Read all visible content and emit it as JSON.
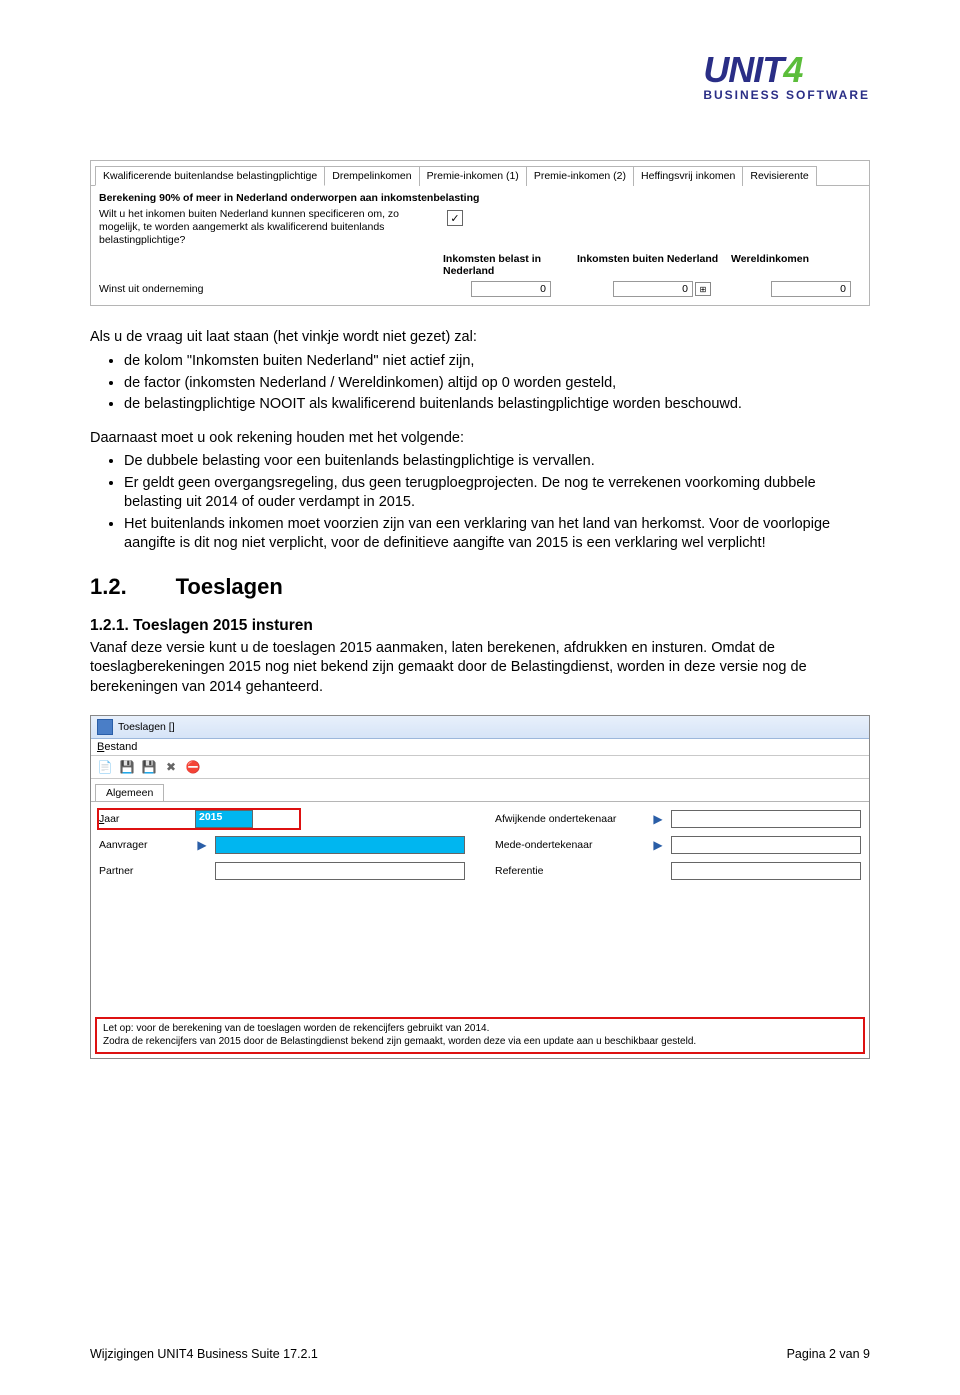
{
  "logo": {
    "main_a": "UNIT",
    "main_b": "4",
    "sub": "BUSINESS SOFTWARE"
  },
  "win1": {
    "tabs": [
      "Kwalificerende buitenlandse belastingplichtige",
      "Drempelinkomen",
      "Premie-inkomen (1)",
      "Premie-inkomen (2)",
      "Heffingsvrij inkomen",
      "Revisierente"
    ],
    "section_title": "Berekening 90% of meer in Nederland onderworpen aan inkomstenbelasting",
    "question": "Wilt u het inkomen buiten Nederland kunnen specificeren om, zo mogelijk, te worden aangemerkt als kwalificerend buitenlands belastingplichtige?",
    "checked": "✓",
    "col1": "Inkomsten belast in Nederland",
    "col2": "Inkomsten buiten Nederland",
    "col3": "Wereldinkomen",
    "row_label": "Winst uit onderneming",
    "v1": "0",
    "v2": "0",
    "v3": "0"
  },
  "body": {
    "intro": "Als u de vraag uit laat staan (het vinkje wordt niet gezet) zal:",
    "b1": "de kolom \"Inkomsten buiten Nederland\" niet actief zijn,",
    "b2": "de factor (inkomsten Nederland / Wereldinkomen) altijd op 0 worden gesteld,",
    "b3": "de belastingplichtige NOOIT als kwalificerend buitenlands belastingplichtige worden beschouwd.",
    "p2": "Daarnaast moet u ook rekening houden met het volgende:",
    "c1": "De dubbele belasting voor een buitenlands belastingplichtige is vervallen.",
    "c2": "Er geldt geen overgangsregeling, dus geen terugploegprojecten. De nog te verrekenen voorkoming dubbele belasting uit 2014 of ouder verdampt in 2015.",
    "c3": "Het buitenlands inkomen moet voorzien zijn van een verklaring van het land van herkomst. Voor de voorlopige aangifte is dit nog niet verplicht, voor de definitieve aangifte van 2015 is een verklaring wel verplicht!",
    "h2_num": "1.2.",
    "h2_title": "Toeslagen",
    "h3": "1.2.1.        Toeslagen 2015 insturen",
    "p3": "Vanaf deze versie kunt u de toeslagen 2015 aanmaken, laten berekenen, afdrukken en insturen. Omdat de toeslagberekeningen 2015 nog niet bekend zijn gemaakt door de Belastingdienst, worden in deze versie nog de berekeningen van 2014 gehanteerd."
  },
  "win2": {
    "title": "Toeslagen []",
    "menu_bestand": "Bestand",
    "tab": "Algemeen",
    "labels": {
      "jaar": "Jaar",
      "aanvrager": "Aanvrager",
      "partner": "Partner",
      "afw": "Afwijkende ondertekenaar",
      "mede": "Mede-ondertekenaar",
      "ref": "Referentie"
    },
    "jaar_value": "2015",
    "note_l1": "Let op: voor de berekening van de toeslagen worden de rekencijfers gebruikt van 2014.",
    "note_l2": "Zodra de rekencijfers van 2015 door de Belastingdienst bekend zijn gemaakt, worden deze via een update aan u beschikbaar gesteld."
  },
  "footer": {
    "left": "Wijzigingen UNIT4 Business Suite 17.2.1",
    "right": "Pagina 2 van 9"
  }
}
